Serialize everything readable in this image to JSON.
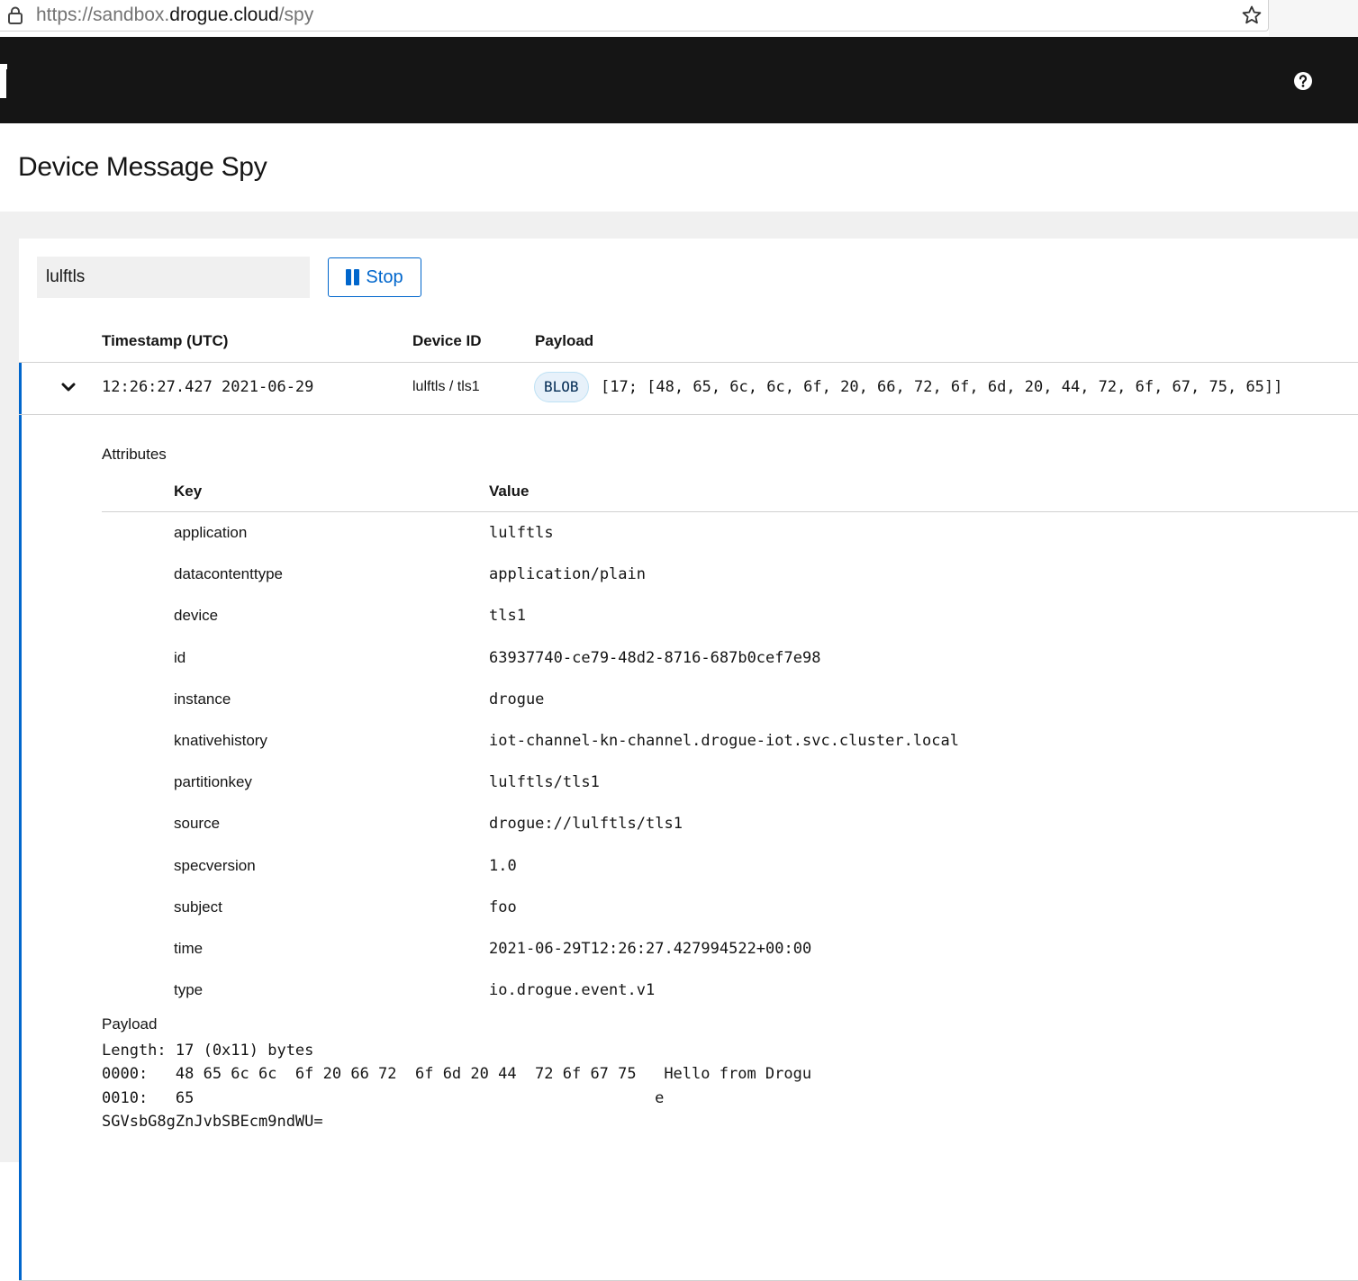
{
  "browser": {
    "url_prefix": "https://sandbox.",
    "url_host": "drogue.cloud",
    "url_path": "/spy"
  },
  "page": {
    "title": "Device Message Spy"
  },
  "controls": {
    "application_value": "lulftls",
    "stop_label": "Stop"
  },
  "table": {
    "headers": {
      "timestamp": "Timestamp (UTC)",
      "device_id": "Device ID",
      "payload": "Payload"
    },
    "row": {
      "timestamp": "12:26:27.427 2021-06-29",
      "device_id": "lulftls / tls1",
      "payload_type": "BLOB",
      "payload_summary": "[17; [48, 65, 6c, 6c, 6f, 20, 66, 72, 6f, 6d, 20, 44, 72, 6f, 67, 75, 65]]"
    }
  },
  "details": {
    "attributes_label": "Attributes",
    "key_header": "Key",
    "value_header": "Value",
    "attributes": [
      {
        "key": "application",
        "value": "lulftls"
      },
      {
        "key": "datacontenttype",
        "value": "application/plain"
      },
      {
        "key": "device",
        "value": "tls1"
      },
      {
        "key": "id",
        "value": "63937740-ce79-48d2-8716-687b0cef7e98"
      },
      {
        "key": "instance",
        "value": "drogue"
      },
      {
        "key": "knativehistory",
        "value": "iot-channel-kn-channel.drogue-iot.svc.cluster.local"
      },
      {
        "key": "partitionkey",
        "value": "lulftls/tls1"
      },
      {
        "key": "source",
        "value": "drogue://lulftls/tls1"
      },
      {
        "key": "specversion",
        "value": "1.0"
      },
      {
        "key": "subject",
        "value": "foo"
      },
      {
        "key": "time",
        "value": "2021-06-29T12:26:27.427994522+00:00"
      },
      {
        "key": "type",
        "value": "io.drogue.event.v1"
      }
    ],
    "payload_label": "Payload",
    "payload_dump": "Length: 17 (0x11) bytes\n0000:   48 65 6c 6c  6f 20 66 72  6f 6d 20 44  72 6f 67 75   Hello from Drogu\n0010:   65                                                  e\nSGVsbG8gZnJvbSBEcm9ndWU="
  },
  "icons": {
    "lock": "lock-icon",
    "star": "star-icon",
    "help": "help-icon",
    "pause": "pause-icon",
    "chevron": "chevron-down-icon"
  },
  "colors": {
    "masthead": "#151515",
    "accent": "#0066cc",
    "badge_bg": "#e7f1fa"
  }
}
